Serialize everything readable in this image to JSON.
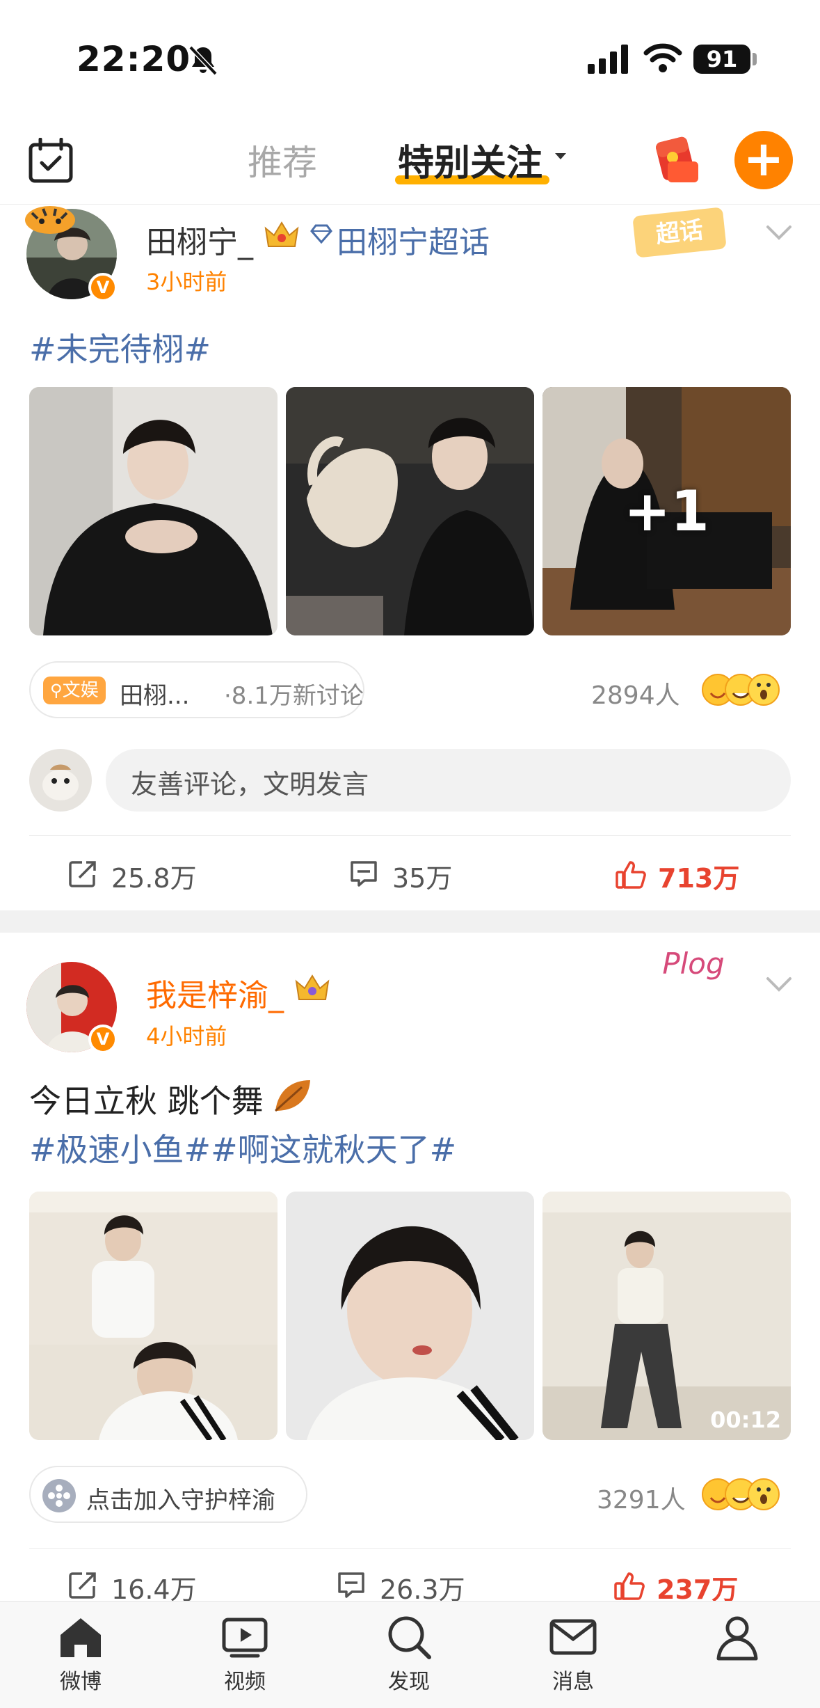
{
  "status_bar": {
    "time": "22:20",
    "battery": "91"
  },
  "top_nav": {
    "tabs": [
      {
        "label": "推荐"
      },
      {
        "label": "特别关注"
      }
    ]
  },
  "posts": [
    {
      "username": "田栩宁_",
      "supertopic": "田栩宁超话",
      "sticker": "超话",
      "time": "3小时前",
      "hashtags": "#未完待栩#",
      "more_count": "+1",
      "topic_tag": "文娱",
      "topic_name": "田栩...",
      "topic_discussion": "·8.1万新讨论",
      "people": "2894人",
      "comment_placeholder": "友善评论，文明发言",
      "reposts": "25.8万",
      "comments": "35万",
      "likes": "713万"
    },
    {
      "username": "我是梓渝_",
      "sticker": "Plog",
      "time": "4小时前",
      "text": "今日立秋 跳个舞",
      "hashtags": "#极速小鱼##啊这就秋天了#",
      "video_duration": "00:12",
      "guard_label": "点击加入守护梓渝",
      "people": "3291人",
      "reposts": "16.4万",
      "comments": "26.3万",
      "likes": "237万"
    }
  ],
  "bottom_nav": [
    {
      "label": "微博",
      "icon": "home-icon"
    },
    {
      "label": "视频",
      "icon": "video-icon"
    },
    {
      "label": "发现",
      "icon": "search-icon"
    },
    {
      "label": "消息",
      "icon": "mail-icon"
    },
    {
      "label": "",
      "icon": "profile-icon"
    }
  ],
  "colors": {
    "accent": "#ff8200",
    "link": "#4a6ea9",
    "like": "#e8432f",
    "tab_underline": "#ffb000"
  }
}
